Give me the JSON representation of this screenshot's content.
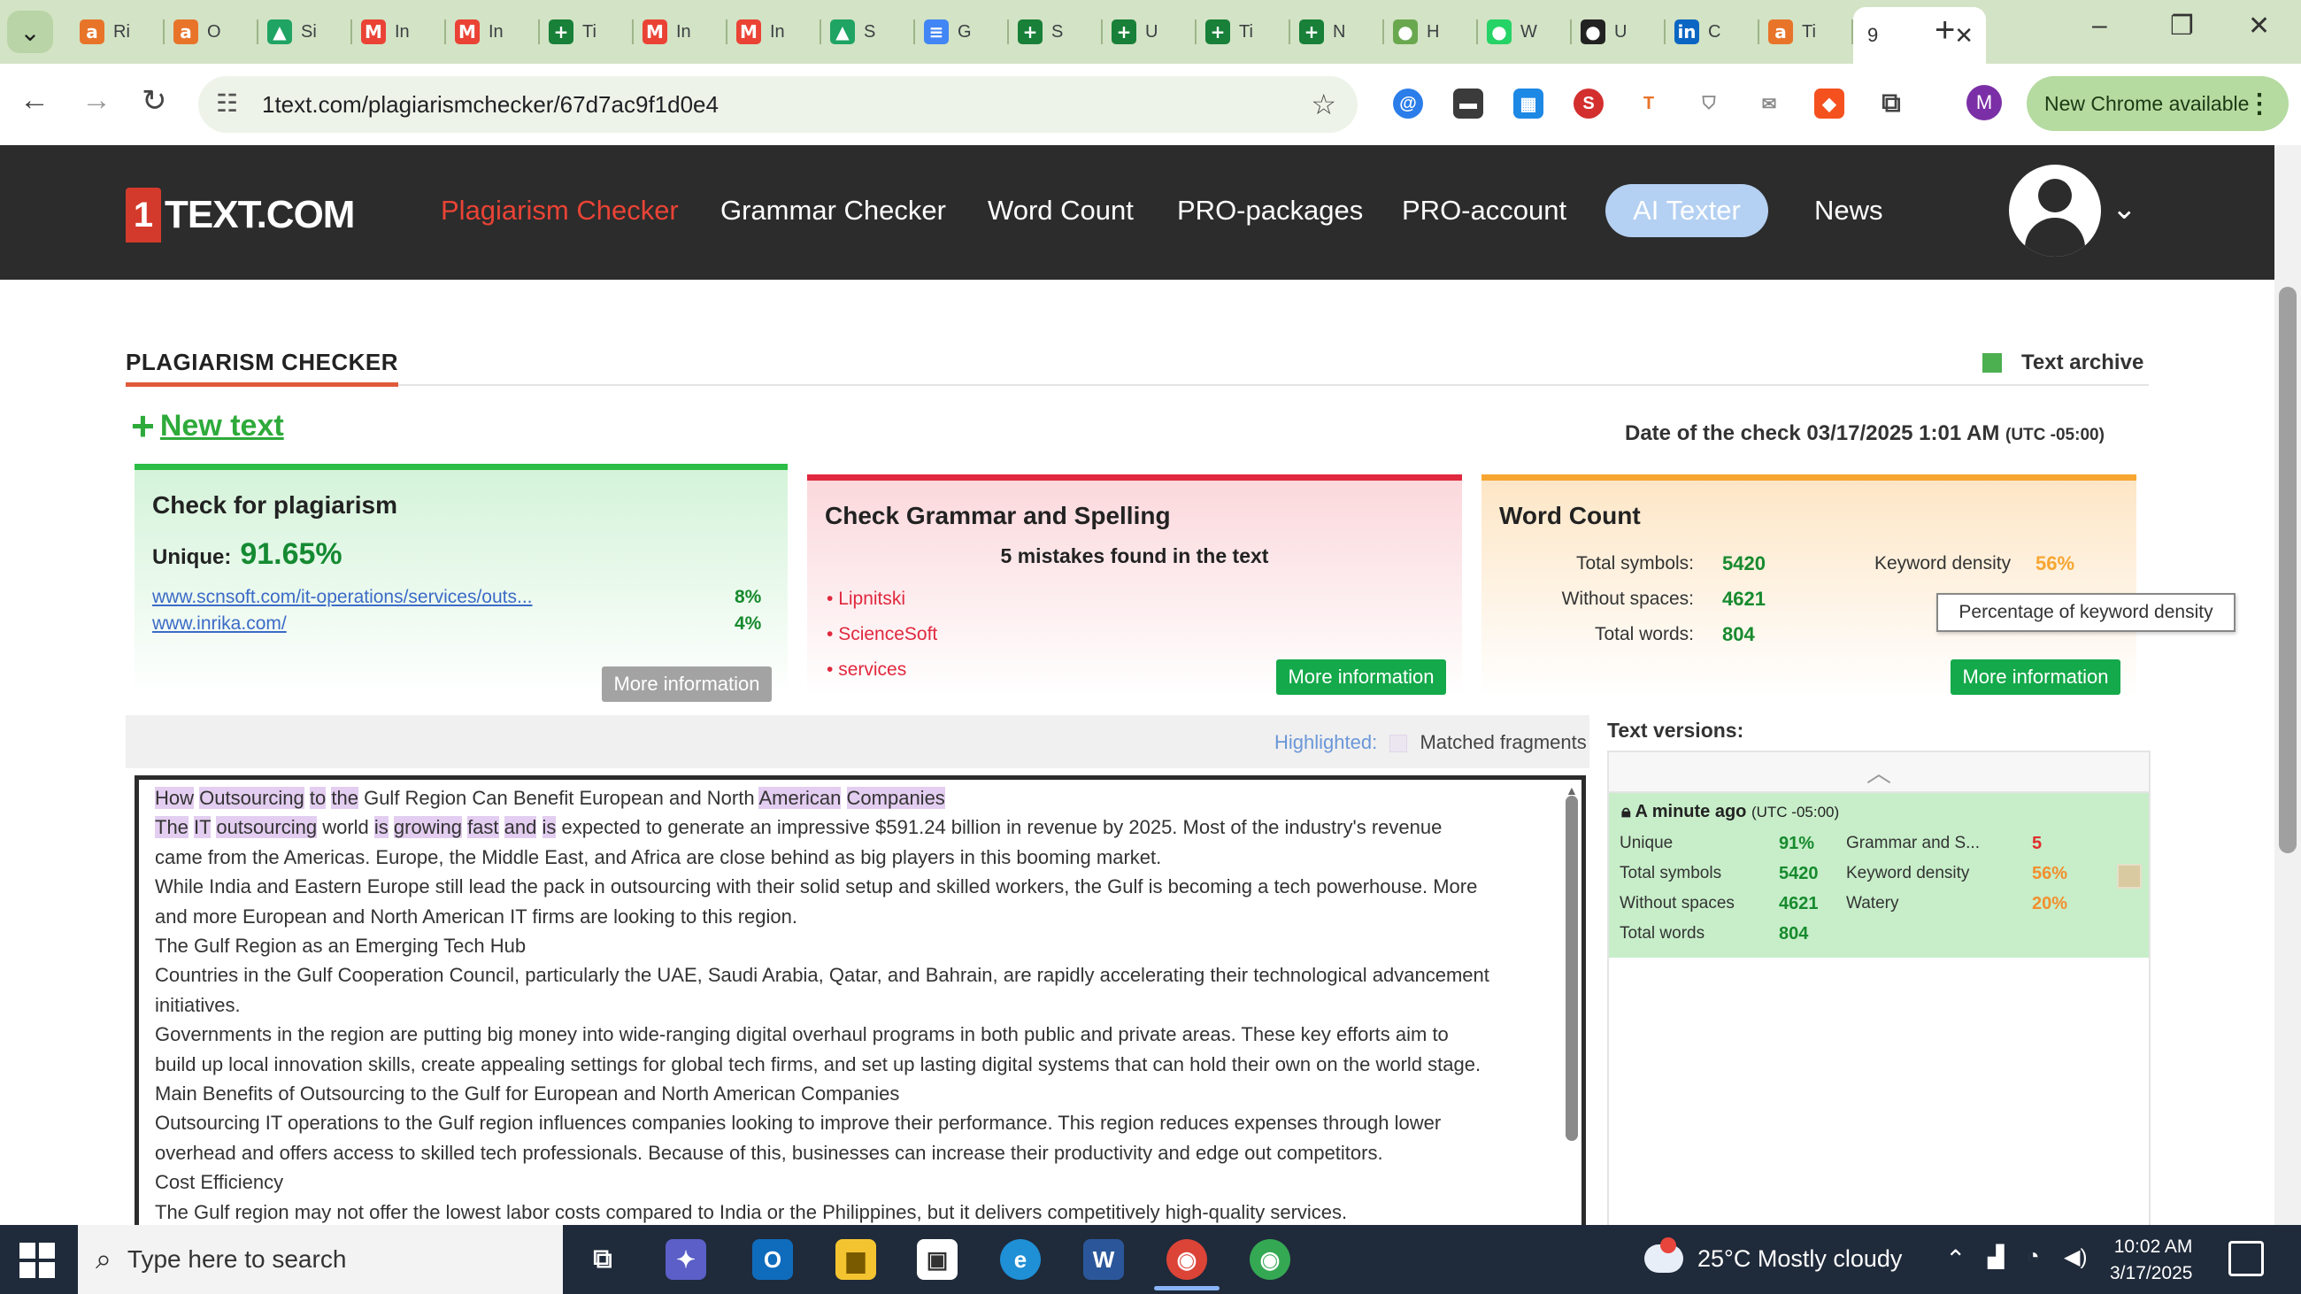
{
  "browser": {
    "tabs": [
      {
        "title": "Ri",
        "icon": "a",
        "color": "#e8742a"
      },
      {
        "title": "O",
        "icon": "a",
        "color": "#e8742a"
      },
      {
        "title": "Si",
        "icon": "▲",
        "color": "#1fa463"
      },
      {
        "title": "In",
        "icon": "M",
        "color": "#ea4335"
      },
      {
        "title": "In",
        "icon": "M",
        "color": "#ea4335"
      },
      {
        "title": "Ti",
        "icon": "+",
        "color": "#188038"
      },
      {
        "title": "In",
        "icon": "M",
        "color": "#ea4335"
      },
      {
        "title": "In",
        "icon": "M",
        "color": "#ea4335"
      },
      {
        "title": "S",
        "icon": "▲",
        "color": "#1fa463"
      },
      {
        "title": "G",
        "icon": "≡",
        "color": "#4285f4"
      },
      {
        "title": "S",
        "icon": "+",
        "color": "#188038"
      },
      {
        "title": "U",
        "icon": "+",
        "color": "#188038"
      },
      {
        "title": "Ti",
        "icon": "+",
        "color": "#188038"
      },
      {
        "title": "N",
        "icon": "+",
        "color": "#188038"
      },
      {
        "title": "H",
        "icon": "●",
        "color": "#6aa84f"
      },
      {
        "title": "W",
        "icon": "●",
        "color": "#25d366"
      },
      {
        "title": "U",
        "icon": "●",
        "color": "#222222"
      },
      {
        "title": "C",
        "icon": "in",
        "color": "#0a66c2"
      },
      {
        "title": "Ti",
        "icon": "a",
        "color": "#e8742a"
      }
    ],
    "active_tab": {
      "title": "9"
    },
    "url": "1text.com/plagiarismchecker/67d7ac9f1d0e4",
    "profile_initial": "M",
    "update_label": "New Chrome available"
  },
  "site": {
    "logo_one": "1",
    "logo_word": "TEXT.COM",
    "nav": [
      "Plagiarism Checker",
      "Grammar Checker",
      "Word Count",
      "PRO-packages",
      "PRO-account",
      "AI Texter",
      "News"
    ]
  },
  "page": {
    "title": "PLAGIARISM CHECKER",
    "archive_label": "Text archive",
    "new_text_label": "New text",
    "date_label": "Date of the check 03/17/2025 1:01 AM",
    "date_tz": "(UTC -05:00)"
  },
  "plagiarism": {
    "title": "Check for plagiarism",
    "unique_label": "Unique:",
    "unique_value": "91.65%",
    "sources": [
      {
        "url": "www.scnsoft.com/it-operations/services/outs...",
        "pct": "8%"
      },
      {
        "url": "www.inrika.com/",
        "pct": "4%"
      }
    ],
    "button": "More information"
  },
  "grammar": {
    "title": "Check Grammar and Spelling",
    "summary": "5 mistakes found in the text",
    "mistakes": [
      "Lipnitski",
      "ScienceSoft",
      "services"
    ],
    "button": "More information"
  },
  "wordcount": {
    "title": "Word Count",
    "total_symbols_label": "Total symbols:",
    "total_symbols": "5420",
    "without_spaces_label": "Without spaces:",
    "without_spaces": "4621",
    "total_words_label": "Total words:",
    "total_words": "804",
    "keyword_density_label": "Keyword density",
    "keyword_density": "56%",
    "tooltip": "Percentage of keyword density",
    "button": "More information"
  },
  "legend": {
    "highlighted": "Highlighted:",
    "matched": "Matched fragments"
  },
  "text_lines": [
    [
      [
        "How",
        true
      ],
      [
        " ",
        false
      ],
      [
        "Outsourcing",
        true
      ],
      [
        " ",
        false
      ],
      [
        "to",
        true
      ],
      [
        " ",
        false
      ],
      [
        "the",
        true
      ],
      [
        " Gulf Region Can Benefit European and North ",
        false
      ],
      [
        "American",
        true
      ],
      [
        " ",
        false
      ],
      [
        "Companies",
        true
      ]
    ],
    [
      [
        "The",
        true
      ],
      [
        " ",
        false
      ],
      [
        "IT",
        true
      ],
      [
        " ",
        false
      ],
      [
        "outsourcing",
        true
      ],
      [
        " world ",
        false
      ],
      [
        "is",
        true
      ],
      [
        " ",
        false
      ],
      [
        "growing",
        true
      ],
      [
        " ",
        false
      ],
      [
        "fast",
        true
      ],
      [
        " ",
        false
      ],
      [
        "and",
        true
      ],
      [
        " ",
        false
      ],
      [
        "is",
        true
      ],
      [
        " expected to generate an impressive $591.24 billion in revenue by 2025. Most of the industry's revenue",
        false
      ]
    ],
    [
      [
        "came from the Americas. Europe, the Middle East, and Africa are close behind as big players in this booming market.",
        false
      ]
    ],
    [
      [
        "While India and Eastern Europe still lead the pack in outsourcing with their solid setup and skilled workers, the Gulf is becoming a tech powerhouse. More",
        false
      ]
    ],
    [
      [
        "and more European and North American IT firms are looking to this region.",
        false
      ]
    ],
    [
      [
        "The Gulf Region as an Emerging Tech Hub",
        false
      ]
    ],
    [
      [
        "Countries in the Gulf Cooperation Council, particularly the UAE, Saudi Arabia, Qatar, and Bahrain, are rapidly accelerating their technological advancement",
        false
      ]
    ],
    [
      [
        "initiatives.",
        false
      ]
    ],
    [
      [
        "Governments in the region are putting big money into wide-ranging digital overhaul programs in both public and private areas. These key efforts aim to",
        false
      ]
    ],
    [
      [
        "build up local innovation skills, create appealing settings for global tech firms, and set up lasting digital systems that can hold their own on the world stage.",
        false
      ]
    ],
    [
      [
        "Main Benefits of Outsourcing to the Gulf for European and North American Companies",
        false
      ]
    ],
    [
      [
        "Outsourcing IT operations to the Gulf region influences companies looking to improve their performance. This region reduces expenses through lower",
        false
      ]
    ],
    [
      [
        "overhead and offers access to skilled tech professionals. Because of this, businesses can increase their productivity and edge out competitors.",
        false
      ]
    ],
    [
      [
        "Cost Efficiency",
        false
      ]
    ],
    [
      [
        "The Gulf region may not offer the lowest labor costs compared to India or the Philippines, but it delivers competitively high-quality services.",
        false
      ]
    ]
  ],
  "versions": {
    "title": "Text versions:",
    "entry": {
      "time": "A minute ago",
      "tz": "(UTC -05:00)",
      "unique_label": "Unique",
      "unique": "91%",
      "total_symbols_label": "Total symbols",
      "total_symbols": "5420",
      "without_spaces_label": "Without spaces",
      "without_spaces": "4621",
      "total_words_label": "Total words",
      "total_words": "804",
      "grammar_label": "Grammar and S...",
      "grammar": "5",
      "keyword_label": "Keyword density",
      "keyword": "56%",
      "watery_label": "Watery",
      "watery": "20%"
    }
  },
  "taskbar": {
    "search_placeholder": "Type here to search",
    "weather": "25°C  Mostly cloudy",
    "time": "10:02 AM",
    "date": "3/17/2025"
  }
}
